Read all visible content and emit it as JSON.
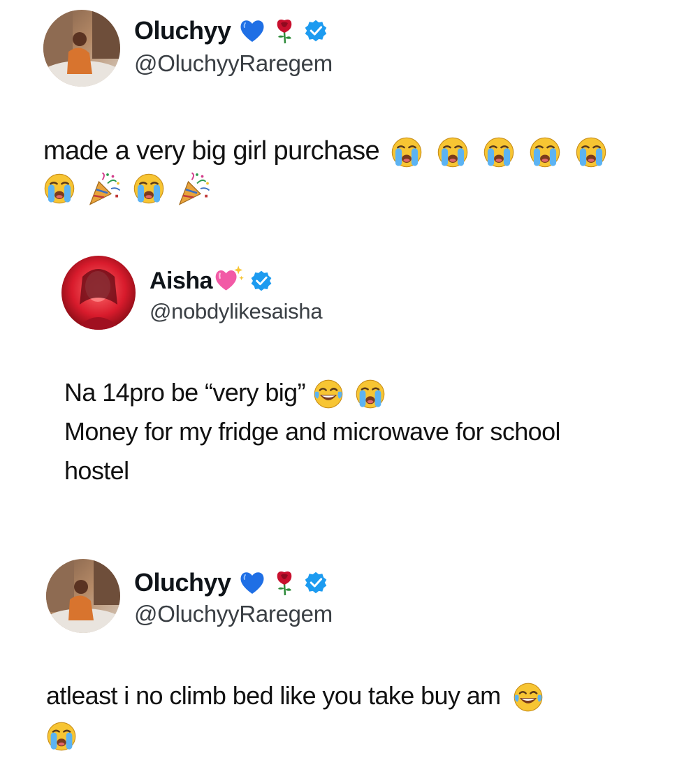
{
  "tweets": [
    {
      "display_name": "Oluchyy",
      "handle": "@OluchyyRaregem",
      "name_emojis": [
        "blue-heart-icon",
        "rose-icon"
      ],
      "verified": true,
      "text_line1": "made a very big girl purchase",
      "line1_emojis": [
        "crying-face-icon",
        "crying-face-icon",
        "crying-face-icon",
        "crying-face-icon",
        "crying-face-icon"
      ],
      "line2_emojis": [
        "crying-face-icon",
        "party-popper-icon",
        "crying-face-icon",
        "party-popper-icon"
      ]
    },
    {
      "display_name": "Aisha",
      "handle": "@nobdylikesaisha",
      "name_emojis": [
        "sparkling-heart-icon"
      ],
      "verified": true,
      "text_line1": "Na 14pro be “very big”",
      "line1_emojis": [
        "tears-of-joy-icon",
        "crying-face-icon"
      ],
      "text_line2": "Money for my fridge and microwave for school",
      "text_line3": "hostel"
    },
    {
      "display_name": "Oluchyy",
      "handle": "@OluchyyRaregem",
      "name_emojis": [
        "blue-heart-icon",
        "rose-icon"
      ],
      "verified": true,
      "text_line1": "atleast i no climb bed like you take buy am",
      "line1_emojis": [
        "tears-of-joy-icon"
      ],
      "line2_emojis": [
        "crying-face-icon"
      ]
    }
  ],
  "colors": {
    "verified_badge": "#1d9bf0",
    "blue_heart": "#1f6fe5",
    "rose": "#c8102e",
    "emoji_yellow": "#f7c533",
    "tear_blue": "#5cb3f2"
  }
}
